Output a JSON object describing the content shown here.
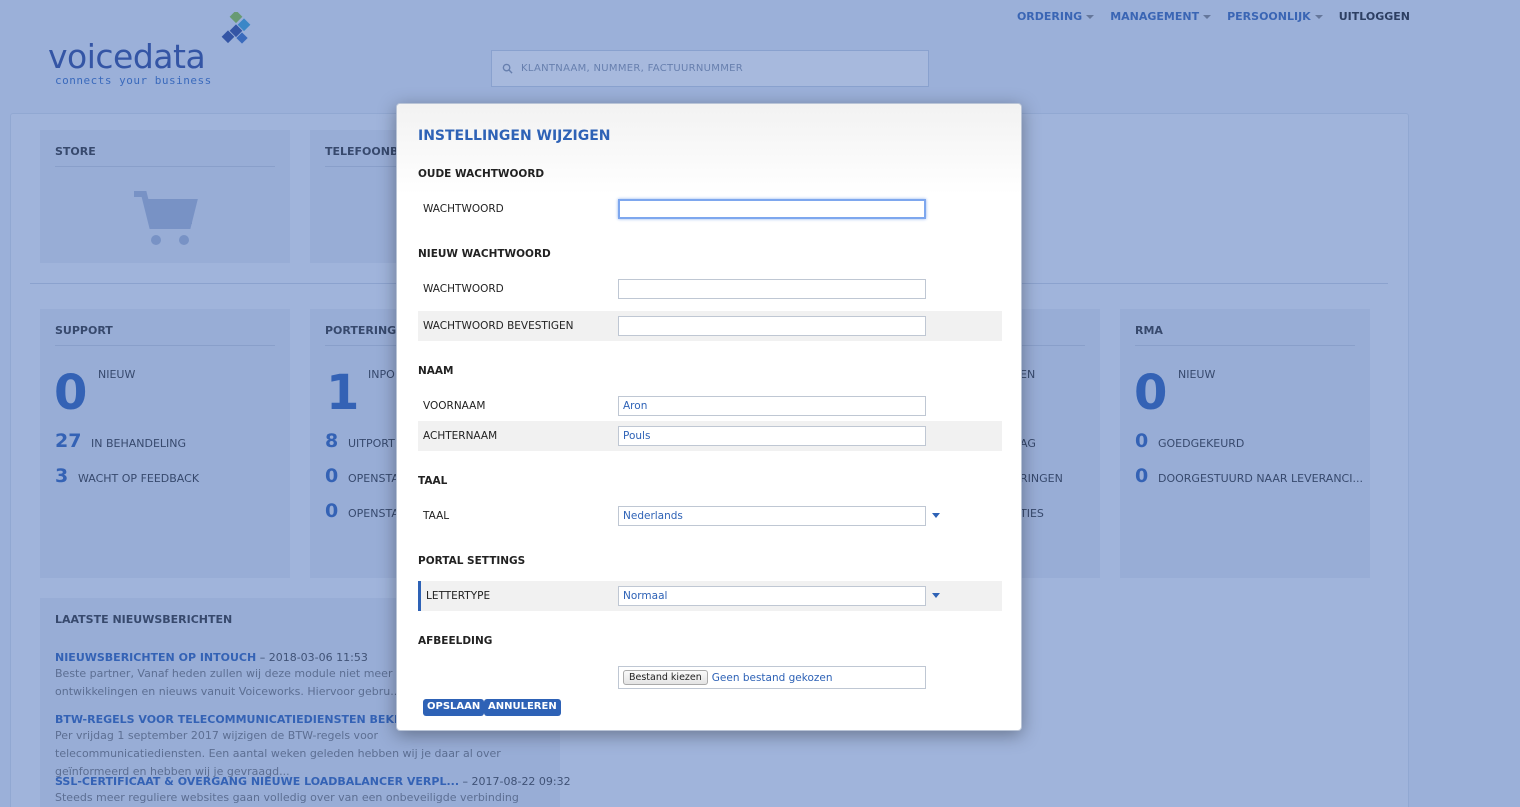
{
  "logo": {
    "word": "voicedata",
    "tagline": "connects your business"
  },
  "nav": {
    "items": [
      "ORDERING",
      "MANAGEMENT",
      "PERSOONLIJK"
    ],
    "logout": "UITLOGGEN"
  },
  "search": {
    "placeholder": "KLANTNAAM, NUMMER, FACTUURNUMMER"
  },
  "cards": {
    "store": {
      "title": "STORE"
    },
    "telefoonboek": {
      "title": "TELEFOONBO"
    },
    "support": {
      "title": "SUPPORT",
      "big": "0",
      "big_label": "NIEUW",
      "rows": [
        {
          "num": "27",
          "label": "IN BEHANDELING"
        },
        {
          "num": "3",
          "label": "WACHT OP FEEDBACK"
        }
      ]
    },
    "porteringen": {
      "title": "PORTERINGEN",
      "big": "1",
      "big_label": "INPO",
      "rows": [
        {
          "num": "8",
          "label": "UITPORT"
        },
        {
          "num": "0",
          "label": "OPENSTA"
        },
        {
          "num": "0",
          "label": "OPENSTA"
        }
      ]
    },
    "hidden_middle": {
      "r1": "EN",
      "r2": "AG",
      "r3": "RINGEN",
      "r4": "TIES"
    },
    "rma": {
      "title": "RMA",
      "big": "0",
      "big_label": "NIEUW",
      "rows": [
        {
          "num": "0",
          "label": "GOEDGEKEURD"
        },
        {
          "num": "0",
          "label": "DOORGESTUURD NAAR LEVERANCI..."
        }
      ]
    }
  },
  "news": {
    "title": "LAATSTE NIEUWSBERICHTEN",
    "items": [
      {
        "link": "NIEUWSBERICHTEN OP INTOUCH",
        "date": " – 2018-03-06 11:53",
        "text": "Beste partner, Vanaf heden zullen wij deze module niet meer gebruike... relevante ontwikkelingen en nieuws vanuit Voiceworks. Hiervoor gebru..."
      },
      {
        "link": "BTW-REGELS VOOR TELECOMMUNICATIEDIENSTEN BEKRACHTIGD",
        "date": "",
        "text": "Per vrijdag 1 september 2017 wijzigen de BTW-regels voor telecommunicatiediensten. Een aantal weken geleden hebben wij je daar al over geïnformeerd en hebben wij je gevraagd..."
      },
      {
        "link": "SSL-CERTIFICAAT & OVERGANG NIEUWE LOADBALANCER VERPL...",
        "date": " – 2017-08-22 09:32",
        "text": "Steeds meer reguliere websites gaan volledig over van een onbeveiligde verbinding (http) naar een"
      }
    ]
  },
  "modal": {
    "title": "INSTELLINGEN WIJZIGEN",
    "sections": {
      "old_password": "OUDE WACHTWOORD",
      "new_password": "NIEUW WACHTWOORD",
      "name": "NAAM",
      "language": "TAAL",
      "portal": "PORTAL SETTINGS",
      "image": "AFBEELDING"
    },
    "fields": {
      "old_password_label": "WACHTWOORD",
      "new_password_label": "WACHTWOORD",
      "confirm_label": "WACHTWOORD BEVESTIGEN",
      "firstname_label": "VOORNAAM",
      "firstname_value": "Aron",
      "lastname_label": "ACHTERNAAM",
      "lastname_value": "Pouls",
      "language_label": "TAAL",
      "language_value": "Nederlands",
      "font_label": "LETTERTYPE",
      "font_value": "Normaal",
      "file_button": "Bestand kiezen",
      "file_status": "Geen bestand gekozen"
    },
    "buttons": {
      "save": "OPSLAAN",
      "cancel": "ANNULEREN"
    }
  },
  "colors": {
    "accent": "#2e62b6",
    "overlay": "#3c64b4"
  }
}
